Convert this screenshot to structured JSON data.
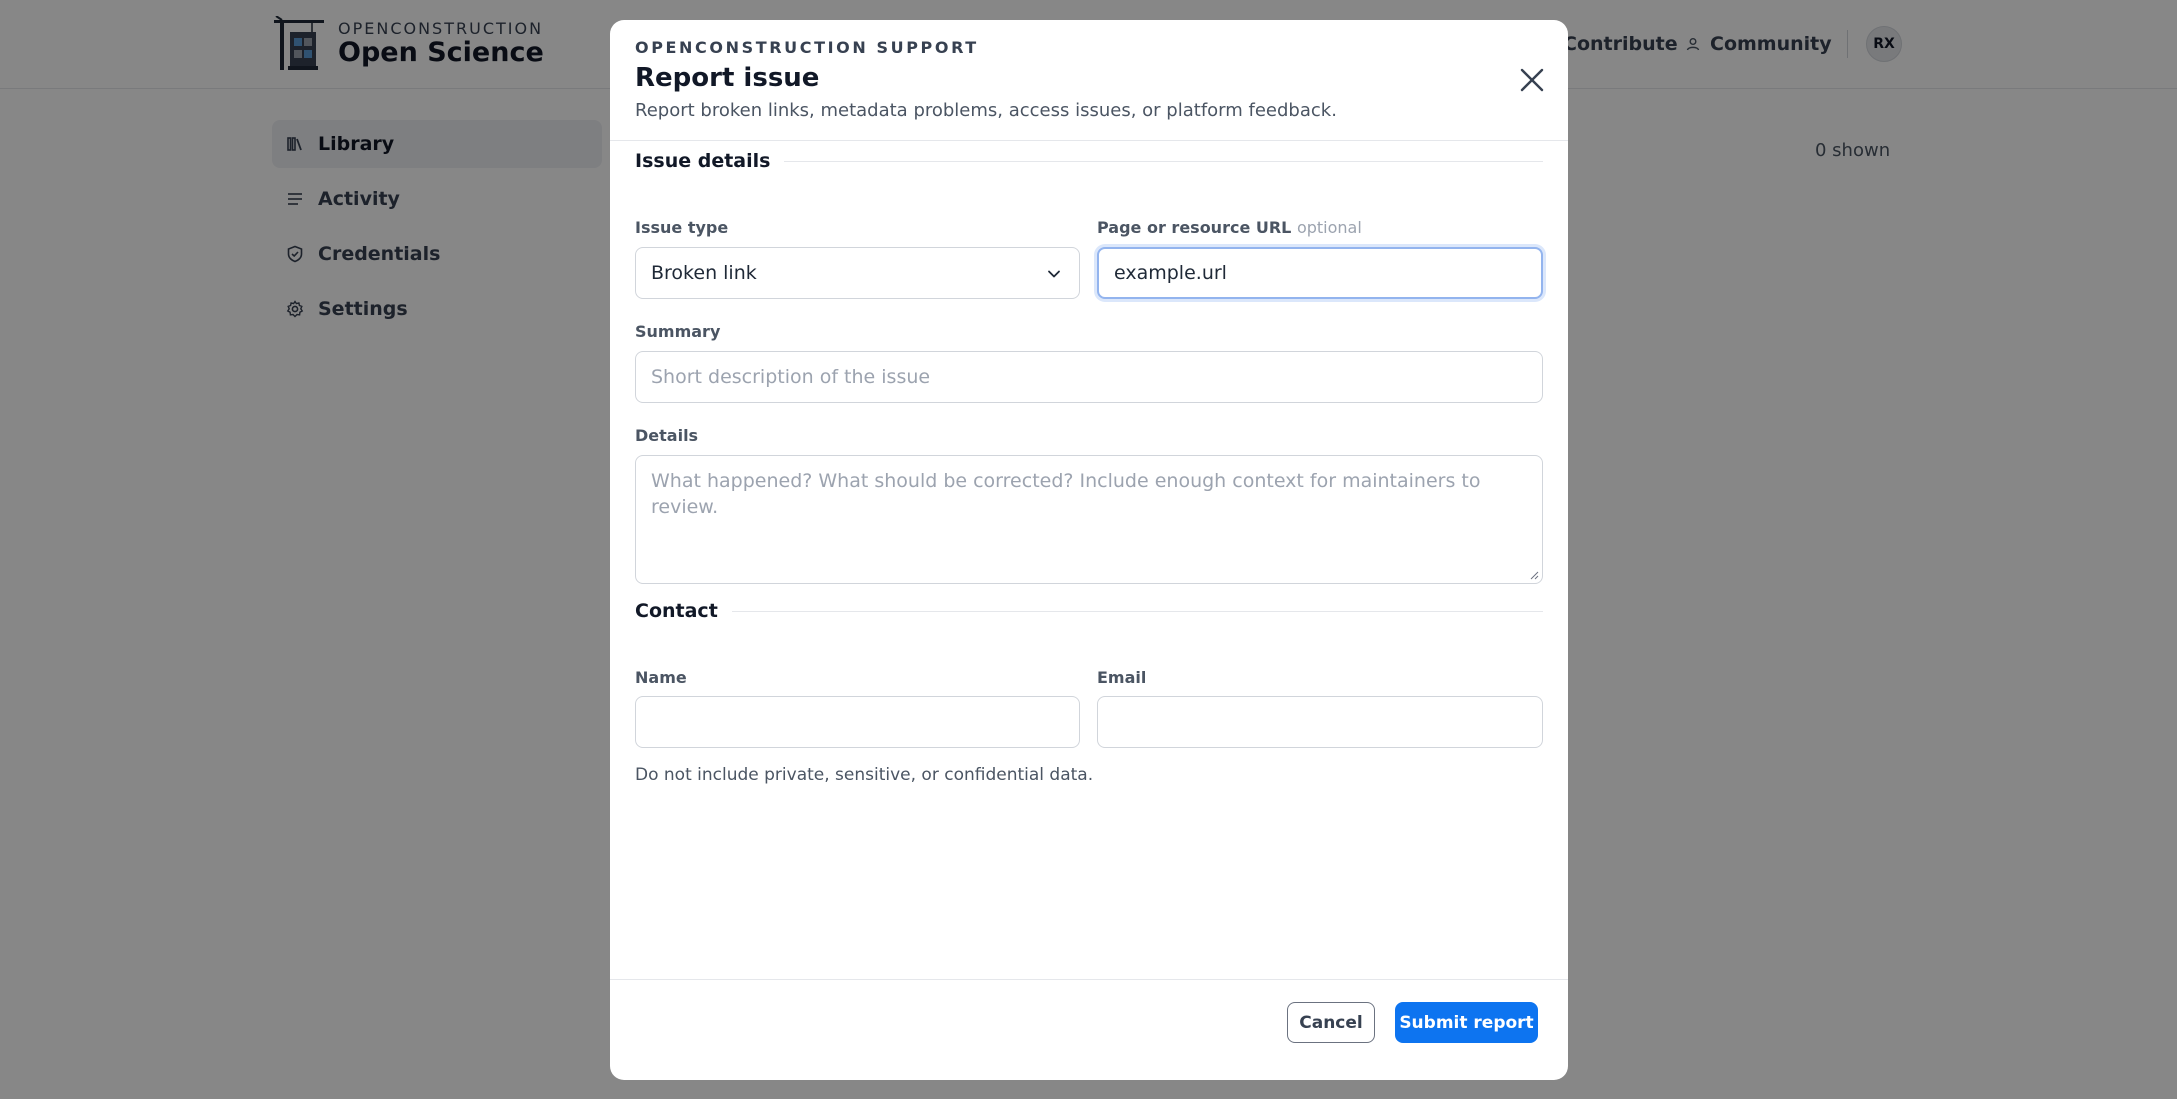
{
  "brand": {
    "top": "OPENCONSTRUCTION",
    "bottom": "Open Science"
  },
  "topnav": {
    "contribute": "Contribute",
    "community": "Community",
    "avatar_initials": "RX"
  },
  "sidebar": {
    "items": [
      {
        "label": "Library",
        "icon": "library-icon",
        "active": true
      },
      {
        "label": "Activity",
        "icon": "list-icon",
        "active": false
      },
      {
        "label": "Credentials",
        "icon": "shield-icon",
        "active": false
      },
      {
        "label": "Settings",
        "icon": "gear-icon",
        "active": false
      }
    ]
  },
  "main": {
    "shown_count": "0 shown"
  },
  "modal": {
    "eyebrow": "OPENCONSTRUCTION SUPPORT",
    "title": "Report issue",
    "subtitle": "Report broken links, metadata problems, access issues, or platform feedback.",
    "sections": {
      "issue_details": "Issue details",
      "contact": "Contact"
    },
    "fields": {
      "issue_type": {
        "label": "Issue type",
        "value": "Broken link"
      },
      "url": {
        "label": "Page or resource URL",
        "optional": "optional",
        "value": "example.url"
      },
      "summary": {
        "label": "Summary",
        "value": "",
        "placeholder": "Short description of the issue"
      },
      "details": {
        "label": "Details",
        "value": "",
        "placeholder": "What happened? What should be corrected? Include enough context for maintainers to review."
      },
      "name": {
        "label": "Name",
        "value": ""
      },
      "email": {
        "label": "Email",
        "value": ""
      }
    },
    "note": "Do not include private, sensitive, or confidential data.",
    "buttons": {
      "cancel": "Cancel",
      "submit": "Submit report"
    }
  },
  "colors": {
    "accent": "#0d74f0",
    "overlay": "rgba(0,0,0,0.47)"
  }
}
